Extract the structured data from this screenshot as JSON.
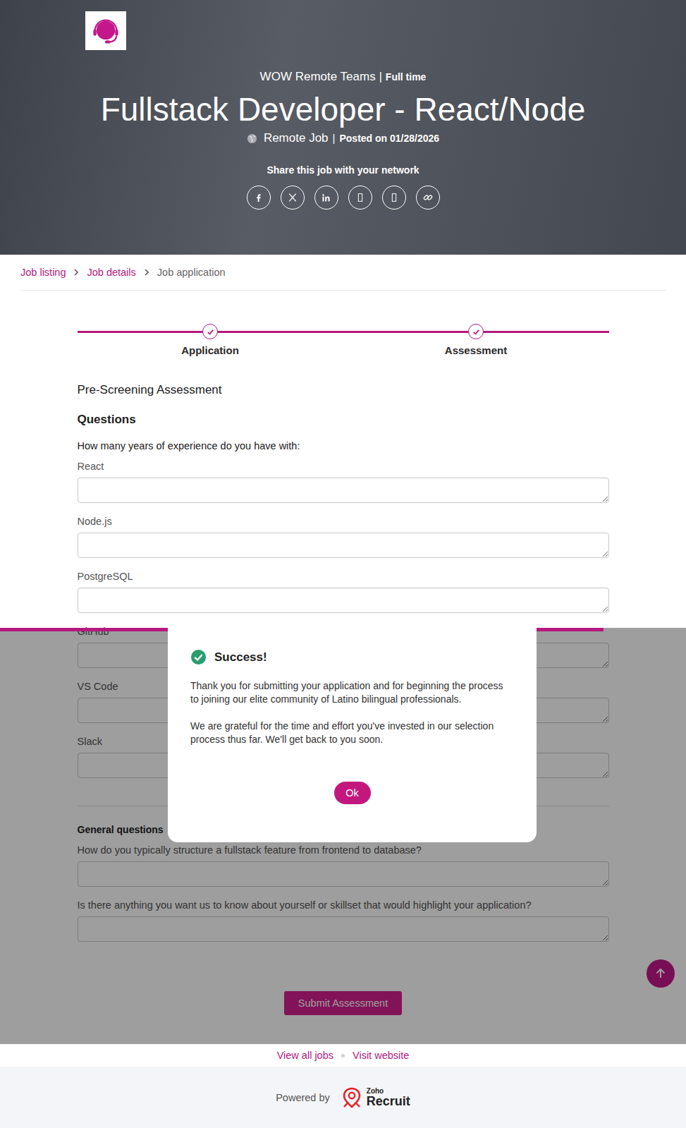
{
  "header": {
    "company": "WOW Remote Teams",
    "separator": "|",
    "employment_type": "Full time",
    "title": "Fullstack Developer - React/Node",
    "location": "Remote Job",
    "posted": "Posted on 01/28/2026",
    "share_label": "Share this job with your network"
  },
  "breadcrumb": [
    {
      "label": "Job listing",
      "current": false
    },
    {
      "label": "Job details",
      "current": false
    },
    {
      "label": "Job application",
      "current": true
    }
  ],
  "steps": [
    {
      "label": "Application",
      "done": true
    },
    {
      "label": "Assessment",
      "done": true
    }
  ],
  "form": {
    "title": "Pre-Screening Assessment",
    "sections": [
      {
        "heading": "Questions",
        "prompt": "How many years of experience do you have with:",
        "fields": [
          {
            "label": "React",
            "value": ""
          },
          {
            "label": "Node.js",
            "value": ""
          },
          {
            "label": "PostgreSQL",
            "value": ""
          },
          {
            "label": "GitHub",
            "value": ""
          },
          {
            "label": "VS Code",
            "value": ""
          },
          {
            "label": "Slack",
            "value": ""
          }
        ]
      },
      {
        "heading": "General questions",
        "prompt": "",
        "fields": [
          {
            "label": "How do you typically structure a fullstack feature from frontend to database?",
            "value": ""
          },
          {
            "label": "Is there anything you want us to know about yourself or skillset that would highlight your application?",
            "value": ""
          }
        ]
      }
    ],
    "submit": "Submit Assessment"
  },
  "footer": {
    "links": [
      "View all jobs",
      "Visit website"
    ],
    "powered_by": "Powered by",
    "brand_top": "Zoho",
    "brand_name": "Recruit"
  },
  "progress": {
    "level": 0.88
  },
  "dialog": {
    "title": "Success!",
    "messages": [
      "Thank you for submitting your application and for beginning the process to joining our elite community of Latino bilingual professionals.",
      "We are grateful for the time and effort you've invested in our selection process thus far. We'll get back to you soon."
    ],
    "button": "Ok"
  }
}
